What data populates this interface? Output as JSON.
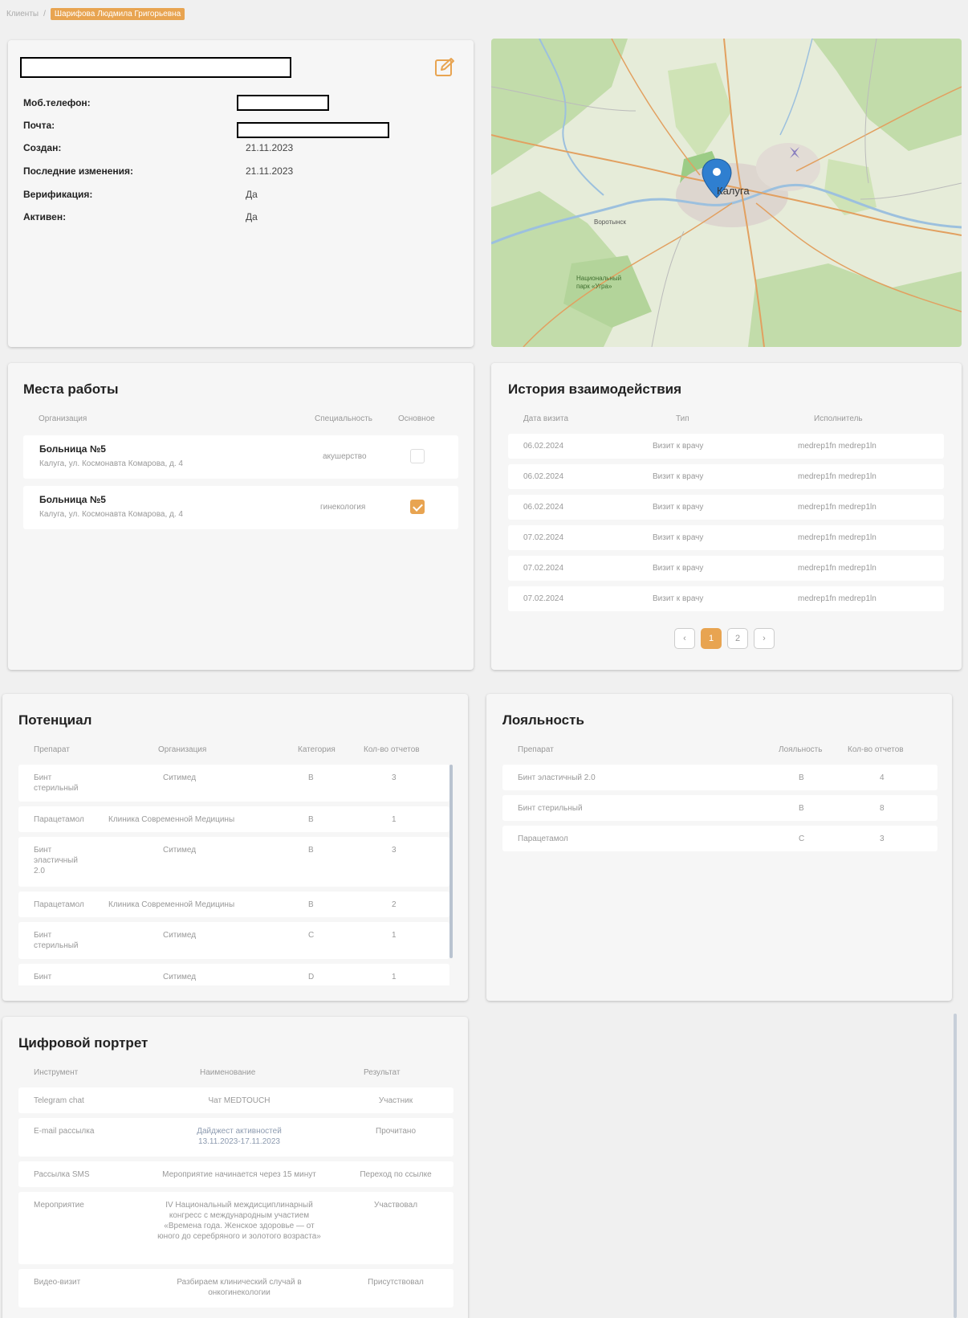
{
  "breadcrumb": {
    "root": "Клиенты",
    "separator": "/",
    "current": "Шарифова Людмила Григорьевна"
  },
  "client": {
    "fields": [
      {
        "label": "Моб.телефон:",
        "value": ""
      },
      {
        "label": "Почта:",
        "value": ""
      },
      {
        "label": "Создан:",
        "value": "21.11.2023"
      },
      {
        "label": "Последние изменения:",
        "value": "21.11.2023"
      },
      {
        "label": "Верификация:",
        "value": "Да"
      },
      {
        "label": "Активен:",
        "value": "Да"
      }
    ]
  },
  "map": {
    "city": "Калуга",
    "places": [
      "Воротынск",
      "Национальный парк «Угра»"
    ]
  },
  "workplaces": {
    "title": "Места работы",
    "headers": {
      "org": "Организация",
      "spec": "Специальность",
      "main": "Основное"
    },
    "rows": [
      {
        "name": "Больница №5",
        "address": "Калуга, ул. Космонавта Комарова, д. 4",
        "spec": "акушерство",
        "main": false
      },
      {
        "name": "Больница №5",
        "address": "Калуга, ул. Космонавта Комарова, д. 4",
        "spec": "гинекология",
        "main": true
      }
    ]
  },
  "history": {
    "title": "История взаимодействия",
    "headers": {
      "date": "Дата визита",
      "type": "Тип",
      "exec": "Исполнитель"
    },
    "rows": [
      {
        "date": "06.02.2024",
        "type": "Визит к врачу",
        "exec": "medrep1fn medrep1ln"
      },
      {
        "date": "06.02.2024",
        "type": "Визит к врачу",
        "exec": "medrep1fn medrep1ln"
      },
      {
        "date": "06.02.2024",
        "type": "Визит к врачу",
        "exec": "medrep1fn medrep1ln"
      },
      {
        "date": "07.02.2024",
        "type": "Визит к врачу",
        "exec": "medrep1fn medrep1ln"
      },
      {
        "date": "07.02.2024",
        "type": "Визит к врачу",
        "exec": "medrep1fn medrep1ln"
      },
      {
        "date": "07.02.2024",
        "type": "Визит к врачу",
        "exec": "medrep1fn medrep1ln"
      }
    ],
    "pager": {
      "prev": "‹",
      "pages": [
        "1",
        "2"
      ],
      "next": "›",
      "current": "1"
    }
  },
  "potential": {
    "title": "Потенциал",
    "headers": {
      "drug": "Препарат",
      "org": "Организация",
      "cat": "Категория",
      "count": "Кол-во отчетов"
    },
    "rows": [
      {
        "drug": "Бинт стерильный",
        "org": "Ситимед",
        "cat": "B",
        "count": "3"
      },
      {
        "drug": "Парацетамол",
        "org": "Клиника Современной Медицины",
        "cat": "B",
        "count": "1"
      },
      {
        "drug": "Бинт эластичный 2.0",
        "org": "Ситимед",
        "cat": "B",
        "count": "3"
      },
      {
        "drug": "Парацетамол",
        "org": "Клиника Современной Медицины",
        "cat": "B",
        "count": "2"
      },
      {
        "drug": "Бинт стерильный",
        "org": "Ситимед",
        "cat": "C",
        "count": "1"
      },
      {
        "drug": "Бинт",
        "org": "Ситимед",
        "cat": "D",
        "count": "1"
      }
    ]
  },
  "loyalty": {
    "title": "Лояльность",
    "headers": {
      "drug": "Препарат",
      "loyalty": "Лояльность",
      "count": "Кол-во отчетов"
    },
    "rows": [
      {
        "drug": "Бинт эластичный 2.0",
        "loyalty": "B",
        "count": "4"
      },
      {
        "drug": "Бинт стерильный",
        "loyalty": "B",
        "count": "8"
      },
      {
        "drug": "Парацетамол",
        "loyalty": "C",
        "count": "3"
      }
    ]
  },
  "digital": {
    "title": "Цифровой портрет",
    "headers": {
      "tool": "Инструмент",
      "name": "Наименование",
      "result": "Результат"
    },
    "rows": [
      {
        "tool": "Telegram chat",
        "name": "Чат MEDTOUCH",
        "result": "Участник"
      },
      {
        "tool": "E-mail рассылка",
        "name": "Дайджест активностей 13.11.2023-17.11.2023",
        "result": "Прочитано"
      },
      {
        "tool": "Рассылка SMS",
        "name": "Мероприятие начинается через 15 минут",
        "result": "Переход по ссылке"
      },
      {
        "tool": "Мероприятие",
        "name": "IV Национальный междисциплинарный конгресс с международным участием «Времена года. Женское здоровье — от юного до серебряного и золотого возраста»",
        "result": "Участвовал"
      },
      {
        "tool": "Видео-визит",
        "name": "Разбираем клинический случай в онкогинекологии",
        "result": "Присутствовал"
      }
    ]
  },
  "colors": {
    "accent": "#e8a451",
    "background": "#f0f0f0",
    "card": "#f6f6f6"
  }
}
